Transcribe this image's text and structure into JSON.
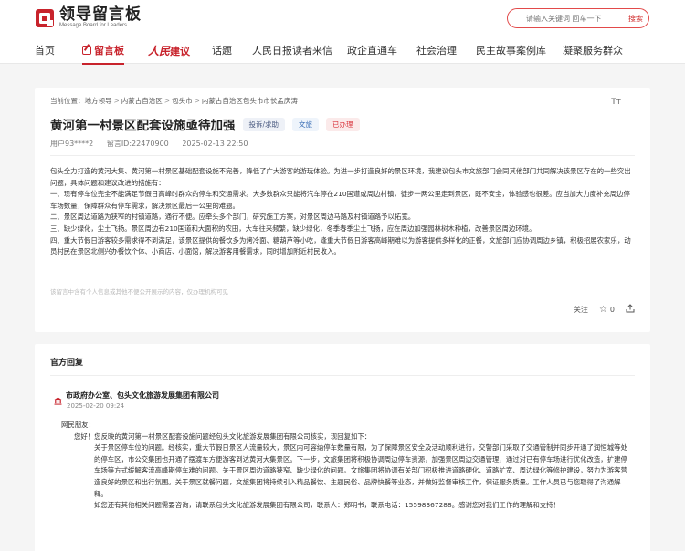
{
  "header": {
    "logo_title": "领导留言板",
    "logo_subtitle": "Message Board for Leaders",
    "search_placeholder": "请输入关键词 回车一下",
    "search_button": "搜索"
  },
  "nav": {
    "items": [
      "首页",
      "留言板",
      "建议",
      "话题",
      "人民日报读者来信",
      "政企直通车",
      "社会治理",
      "民主故事案例库",
      "凝聚服务群众"
    ],
    "brand_prefix": "人民"
  },
  "message": {
    "breadcrumb_label": "当前位置：",
    "breadcrumb": [
      "地方领导",
      "内蒙古自治区",
      "包头市",
      "内蒙古自治区包头市市长孟庆涛"
    ],
    "font_toggle": "Tт",
    "title": "黄河第一村景区配套设施亟待加强",
    "tags": {
      "type": "投诉/求助",
      "category": "文旅",
      "status": "已办理"
    },
    "meta": {
      "user": "用户93****2",
      "id": "留言ID:22470900",
      "time": "2025-02-13 22:50"
    },
    "paragraphs": [
      "包头全力打造的黄河大集、黄河第一村景区基础配套设施不完善，降低了广大游客的游玩体验。为进一步打造良好的景区环境，我建议包头市文旅部门会同其他部门共同解决该景区存在的一些突出问题，具体问题和建议改进的措施有：",
      "一、现有停车位完全不能满足节假日高峰时群众的停车和交通需求。大多数群众只能将汽车停在210国道或周边村镇，徒步一两公里走到景区，既不安全，体验感也很差。应当加大力度补充周边停车场数量，保障群众有停车需求，解决景区最后一公里的难题。",
      "二、景区周边道路为狭窄的村镇道路，通行不便。应牵头多个部门，研究施工方案，对景区周边马路及村镇道路予以拓宽。",
      "三、缺少绿化，尘土飞扬。景区周边有210国道和大面积的农田，大车往来频繁，缺少绿化，冬季春季尘土飞扬，应在周边加强园林树木种植，改善景区周边环境。",
      "四、重大节假日游客较多需求得不到满足，该景区提供的餐饮多为烤冷面、糖葫芦等小吃，逢重大节假日游客高峰期难以为游客提供多样化的正餐，文旅部门应协调周边乡镇，积极招展农家乐，动员村民在景区北侧兴办餐饮个体、小商店、小面馆，解决游客用餐需求，同时增加附近村民收入。"
    ],
    "disclaimer": "该留言中含有个人信息或其他不便公开展示的内容，仅办理机构可见",
    "actions": {
      "follow": "关注",
      "like_count": "0"
    }
  },
  "reply": {
    "section_title": "官方回复",
    "org": "市政府办公室、包头文化旅游发展集团有限公司",
    "time": "2025-02-20 09:24",
    "greeting": "网民朋友：",
    "paragraphs": [
      "您好！您反映的黄河第一村景区配套设施问题经包头文化旅游发展集团有限公司核实，现回复如下：",
      "关于景区停车位的问题。经核实，重大节假日景区人流量较大，景区内可容纳停车数量有限，为了保障景区安全及活动顺利进行，交警部门采取了交通管制并同步开通了润恒城等处的停车区，市公交集团也开通了摆渡车方便游客到达黄河大集景区。下一步，文旅集团将积极协调周边停车资源，加强景区周边交通管理，通过对已有停车场进行优化改造，扩建停车场等方式缓解客流高峰期停车难的问题。关于景区周边道路狭窄、缺少绿化的问题。文旅集团将协调有关部门积极推进道路硬化、道路扩宽、周边绿化等修护建设，努力为游客营造良好的景区和出行氛围。关于景区就餐问题，文旅集团将持续引入精品餐饮、主题民俗、品牌快餐等业态，并做好监督审核工作，保证服务质量。工作人员已与您取得了沟通解释。",
      "如您还有其他相关问题需要咨询，请联系包头文化旅游发展集团有限公司，联系人：郑明书，联系电话：15598367288。感谢您对我们工作的理解和支持！"
    ]
  },
  "colors": {
    "brand_red": "#c8232c",
    "tag_red": "#d9363e",
    "tag_blue": "#3b6fb6",
    "background": "#f5f5f5"
  }
}
